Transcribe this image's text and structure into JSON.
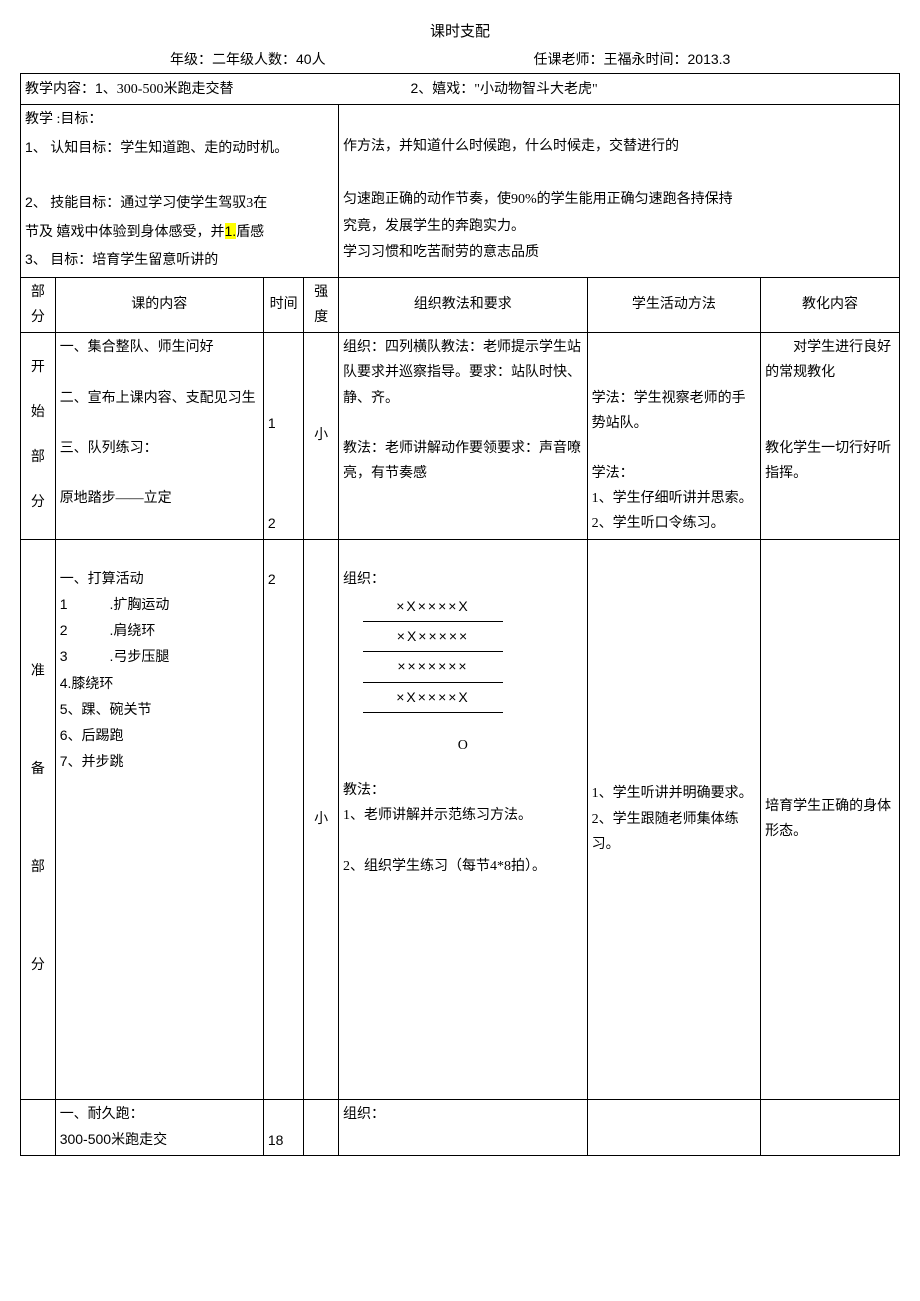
{
  "title": "课时支配",
  "header": {
    "grade_label": "年级：",
    "grade": "二年级",
    "count_label": "人数：",
    "count": "40",
    "count_unit": "人",
    "teacher_label": "任课老师：",
    "teacher": "王福永",
    "time_label": "时间：",
    "time": "2013.3"
  },
  "teaching_content": {
    "label": "教学内容：",
    "item1_num": "1、",
    "item1": "300-500米跑走交替",
    "item2_num": "2、",
    "item2": "嬉戏：\"小动物智斗大老虎\""
  },
  "goals": {
    "left_label": "教学",
    "left_1": "1、",
    "left_2": "2、",
    "left_3": "节及",
    "left_4": "3、",
    "right_label": ":目标：",
    "cog_label": "认知目标：",
    "cog_text_l": "学生知道跑、走的动时机。",
    "cog_text_r": "作方法，并知道什么时候跑，什么时候走，交替进行的",
    "skill_label": "技能目标：",
    "skill_text_l1": "通过学习使学生驾驭3在",
    "skill_text_l2": "嬉戏中体验到身体感受，并",
    "skill_hl": "1.",
    "skill_text_l3": "盾感",
    "skill_text_r1": "匀速跑正确的动作节奏，使90%的学生能用正确匀速跑各持保持",
    "skill_text_r2": "究竟，发展学生的奔跑实力。",
    "moral_label": "目标：",
    "moral_text_l": "培育学生留意听讲的",
    "moral_text_r": "学习习惯和吃苦耐劳的意志品质"
  },
  "columns": {
    "part": "部分",
    "content": "课的内容",
    "time": "时间",
    "intensity": "强度",
    "org": "组织教法和要求",
    "activity": "学生活动方法",
    "edu": "教化内容"
  },
  "start": {
    "part_label": "开始部分",
    "c1": "一、集合整队、师生问好",
    "c2": "二、宣布上课内容、支配见习生",
    "c3": "三、队列练习：",
    "c4": "原地踏步——立定",
    "t1": "1",
    "t2": "2",
    "intensity": "小",
    "org1": "组织：四列横队教法：老师提示学生站队要求并巡察指导。要求：站队时快、静、齐。",
    "org2": "教法：老师讲解动作要领要求：声音嘹亮，有节奏感",
    "act1": "学法：学生视察老师的手势站队。",
    "act2_h": "学法：",
    "act2_1": "1、学生仔细听讲并思索。",
    "act2_2": "2、学生听口令练习。",
    "edu1": "　　对学生进行良好的常规教化",
    "edu2": "教化学生一切行好听指挥。"
  },
  "prep": {
    "part_label": "准备部分",
    "c_head": "一、打算活动",
    "c1": "1　　　.扩胸运动",
    "c2": "2　　　.肩绕环",
    "c3": "3　　　.弓步压腿",
    "c4": "4.膝绕环",
    "c5": "5、踝、碗关节",
    "c6": "6、后踢跑",
    "c7": "7、并步跳",
    "t": "2",
    "intensity": "小",
    "org_head": "组织：",
    "d1": "×X××××X",
    "d2": "×X×××××",
    "d3": "×××××××",
    "d4": "×X××××X",
    "circle": "O",
    "org2_h": "教法：",
    "org2_1": "1、老师讲解并示范练习方法。",
    "org2_2": "2、组织学生练习（每节4*8拍）。",
    "act1": "1、学生听讲并明确要求。",
    "act2": "2、学生跟随老师集体练习。",
    "edu": "培育学生正确的身体形态。"
  },
  "main": {
    "c_head": "一、耐久跑：",
    "c1": "300-500米跑走交",
    "t": "18",
    "org_head": "组织："
  }
}
